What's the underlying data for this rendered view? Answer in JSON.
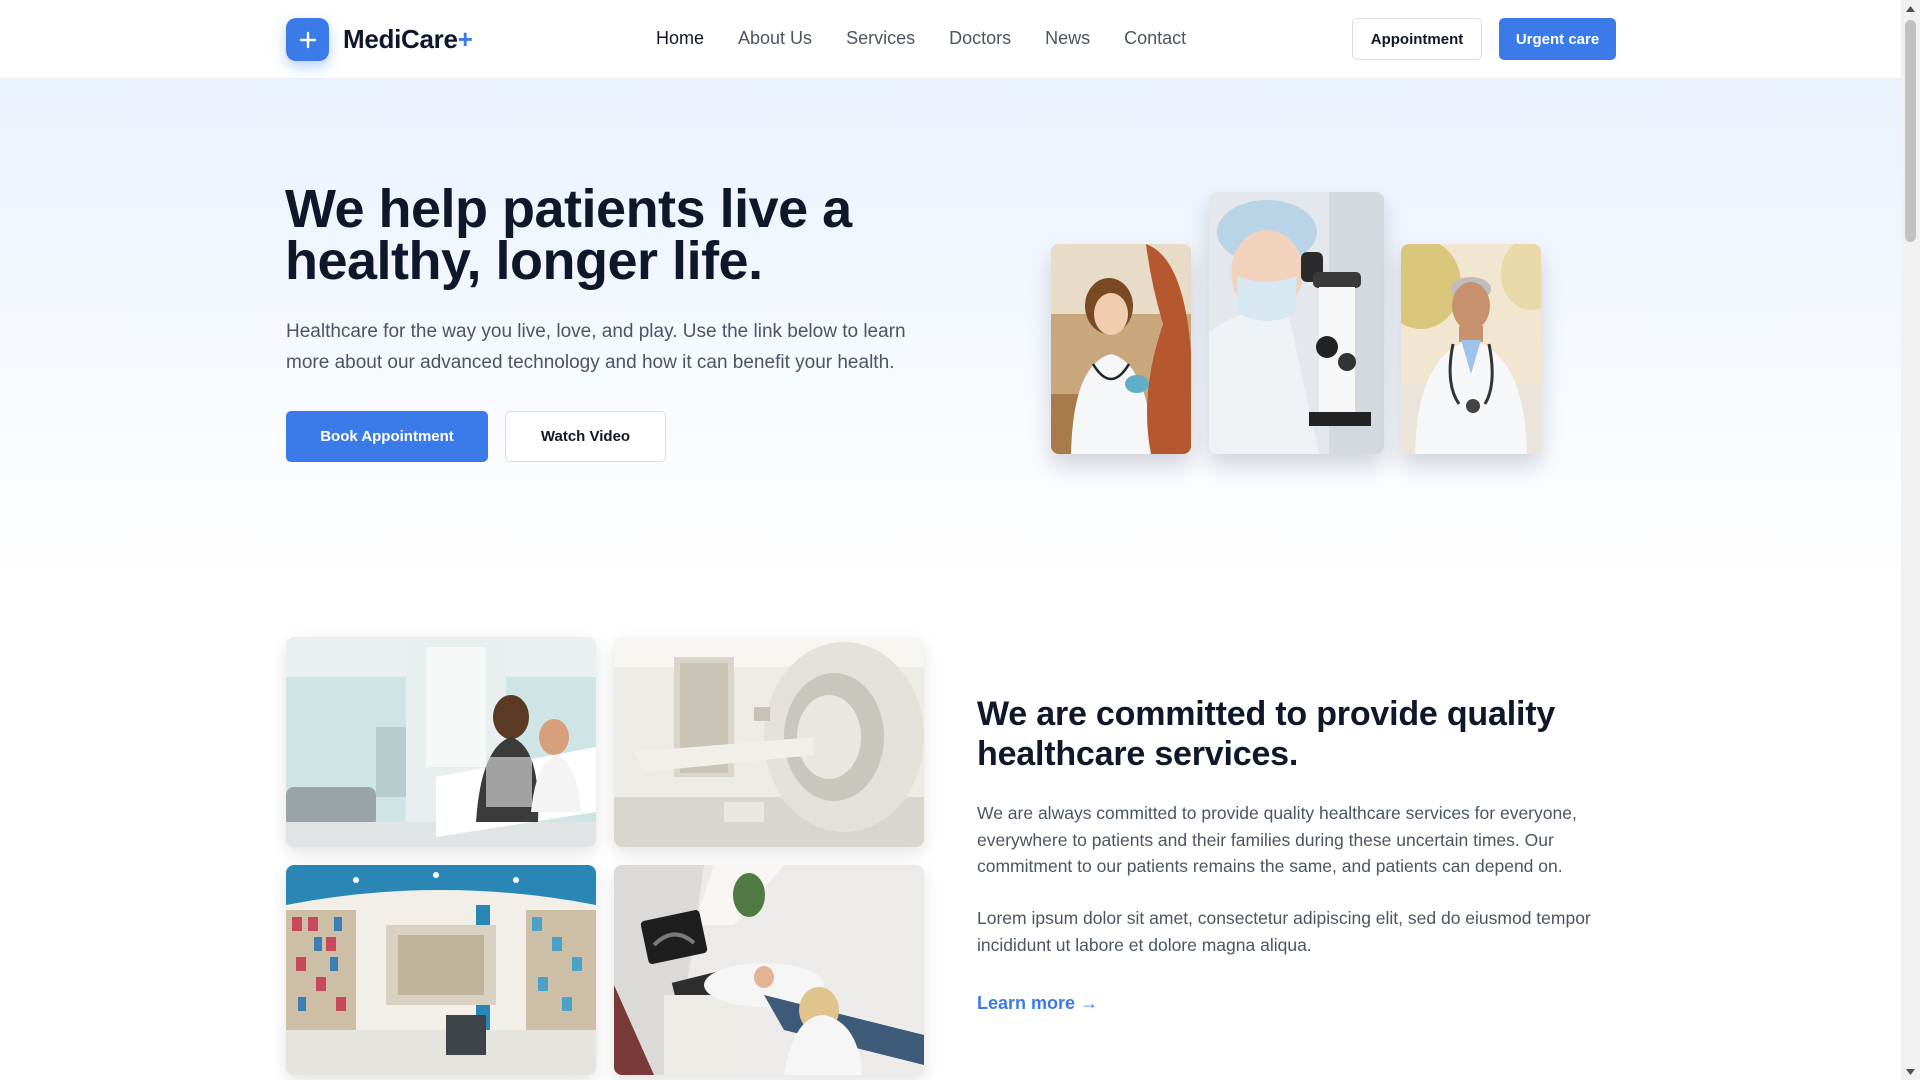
{
  "brand": {
    "name": "MediCare",
    "plus": "+"
  },
  "nav": {
    "items": [
      "Home",
      "About Us",
      "Services",
      "Doctors",
      "News",
      "Contact"
    ],
    "active": "Home"
  },
  "header_actions": {
    "appointment": "Appointment",
    "urgent": "Urgent care"
  },
  "hero": {
    "title": "We help patients live a healthy, longer life.",
    "subtitle": "Healthcare for the way you live, love, and play. Use the link below to learn more about our advanced technology and how it can benefit your health.",
    "primary_button": "Book Appointment",
    "secondary_button": "Watch Video"
  },
  "about": {
    "title": "We are committed to provide quality healthcare services.",
    "paragraph1": "We are always committed to provide quality healthcare services for everyone, everywhere to patients and their families during these uncertain times. Our commitment to our patients remains the same, and patients can depend on.",
    "paragraph2": "Lorem ipsum dolor sit amet, consectetur adipiscing elit, sed do eiusmod tempor incididunt ut labore et dolore magna aliqua.",
    "link": "Learn more →"
  },
  "colors": {
    "accent": "#3b7be9",
    "heading": "#0f172a",
    "body": "#4b5563",
    "hero_bg": "#eaf2fd"
  },
  "icons": {
    "logo": "plus-icon",
    "scroll_up": "arrow-up-icon",
    "scroll_down": "arrow-down-icon"
  }
}
